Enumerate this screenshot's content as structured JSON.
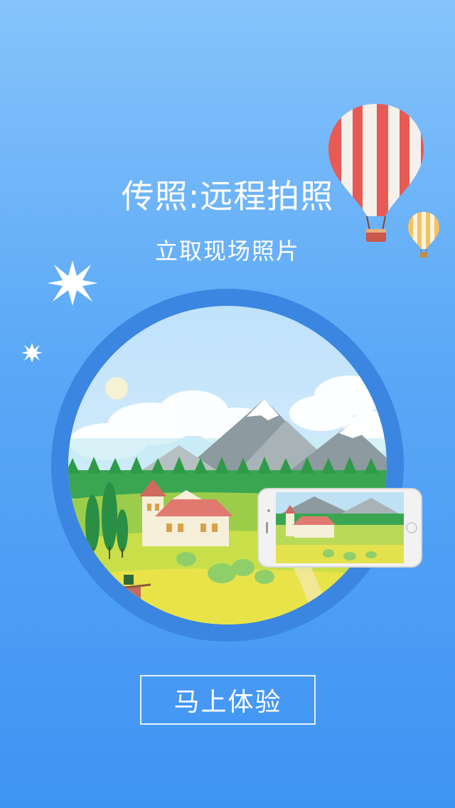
{
  "hero": {
    "title": "传照:远程拍照",
    "subtitle": "立取现场照片"
  },
  "cta": {
    "label": "马上体验"
  },
  "colors": {
    "background_top": "#86c3fb",
    "background_bottom": "#3f93f2",
    "circle_ring": "#3a86e0",
    "balloon_red": "#e85a54",
    "balloon_yellow": "#f5c261"
  },
  "icons": [
    "sparkle-icon",
    "hot-air-balloon-icon",
    "phone-icon"
  ]
}
